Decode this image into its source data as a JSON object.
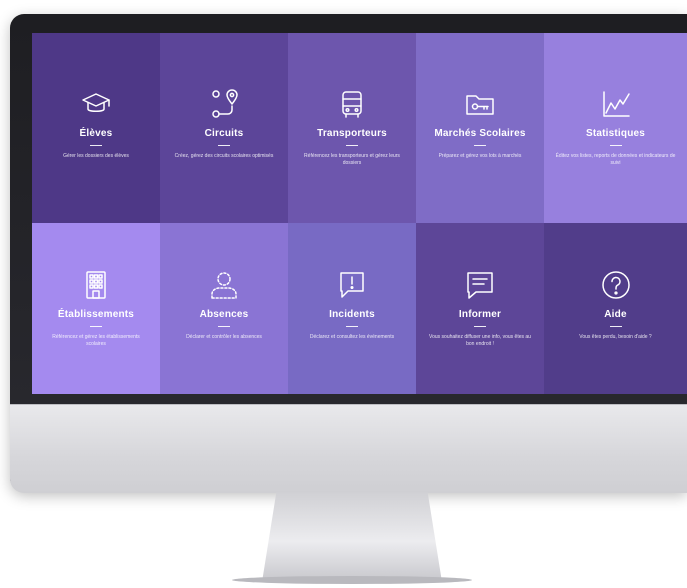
{
  "tiles": [
    {
      "title": "Élèves",
      "desc": "Gérer les dossiers des élèves",
      "icon": "graduation-cap-icon",
      "color": "#4e3887"
    },
    {
      "title": "Circuits",
      "desc": "Créez, gérez des circuits scolaires optimisés",
      "icon": "route-pin-icon",
      "color": "#5c4599"
    },
    {
      "title": "Transporteurs",
      "desc": "Référencez les transporteurs et gérez leurs dossiers",
      "icon": "bus-icon",
      "color": "#6d56ad"
    },
    {
      "title": "Marchés Scolaires",
      "desc": "Préparez et gérez vos lots à marchés",
      "icon": "folder-key-icon",
      "color": "#7f6cc6"
    },
    {
      "title": "Statistiques",
      "desc": "Éditez vos listes, reports de données et indicateurs de suivi",
      "icon": "line-chart-icon",
      "color": "#9780de"
    },
    {
      "title": "Établissements",
      "desc": "Référencez et gérez les établissements scolaires",
      "icon": "building-icon",
      "color": "#a48aef"
    },
    {
      "title": "Absences",
      "desc": "Déclarer et contrôler les absences",
      "icon": "person-dashed-icon",
      "color": "#8a74d4"
    },
    {
      "title": "Incidents",
      "desc": "Déclarez et consultez les événements",
      "icon": "alert-bubble-icon",
      "color": "#786ac4"
    },
    {
      "title": "Informer",
      "desc": "Vous souhaitez diffuser une info, vous êtes au bon endroit !",
      "icon": "message-icon",
      "color": "#5d4698"
    },
    {
      "title": "Aide",
      "desc": "Vous êtes perdu, besoin d'aide ?",
      "icon": "help-circle-icon",
      "color": "#513d8a"
    }
  ]
}
